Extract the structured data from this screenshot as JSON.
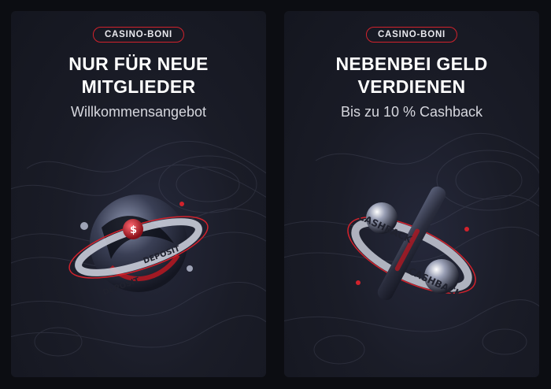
{
  "cards": [
    {
      "badge": "CASINO-BONI",
      "title_line1": "NUR FÜR NEUE",
      "title_line2": "MITGLIEDER",
      "subtitle": "Willkommensangebot",
      "art_icon": "deposit-sphere-icon",
      "art_text": "DEPOSIT",
      "art_symbol": "$"
    },
    {
      "badge": "CASINO-BONI",
      "title_line1": "NEBENBEI GELD",
      "title_line2": "VERDIENEN",
      "subtitle": "Bis zu 10 % Cashback",
      "art_icon": "cashback-percent-icon",
      "art_text": "CASHBACK"
    }
  ],
  "colors": {
    "accent": "#d2222c",
    "background": "#0c0d12",
    "card": "#1a1c27"
  }
}
